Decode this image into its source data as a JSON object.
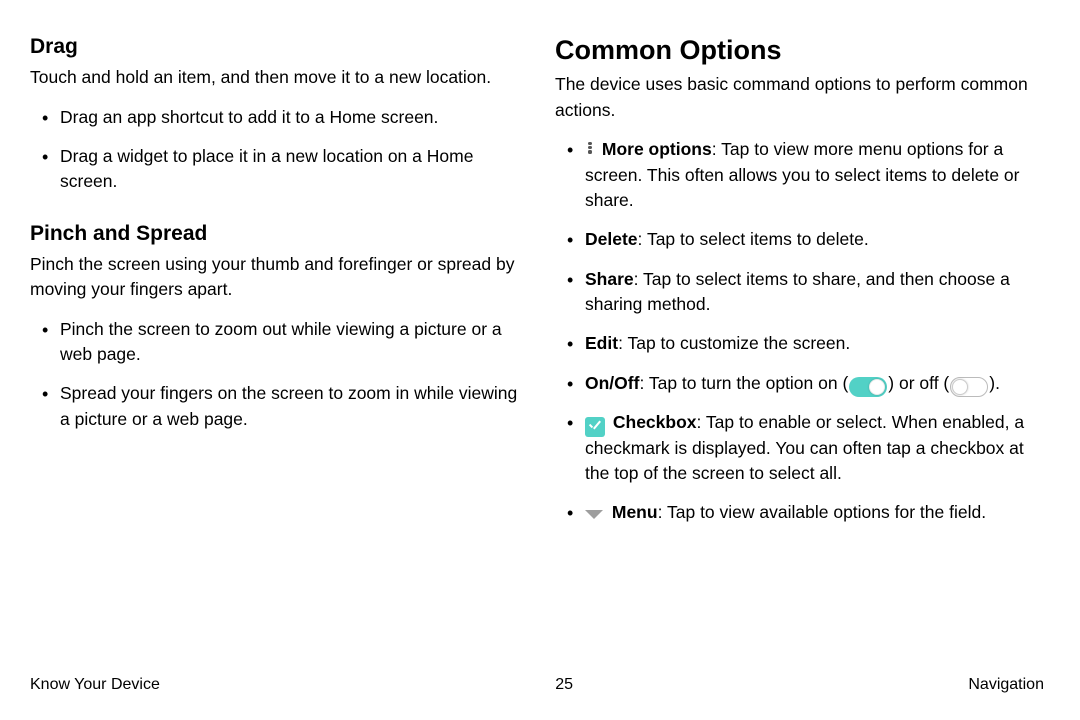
{
  "left": {
    "drag": {
      "heading": "Drag",
      "intro": "Touch and hold an item, and then move it to a new location.",
      "bullets": [
        "Drag an app shortcut to add it to a Home screen.",
        "Drag a widget to place it in a new location on a Home screen."
      ]
    },
    "pinch": {
      "heading": "Pinch and Spread",
      "intro": "Pinch the screen using your thumb and forefinger or spread by moving your fingers apart.",
      "bullets": [
        "Pinch the screen to zoom out while viewing a picture or a web page.",
        "Spread your fingers on the screen to zoom in while viewing a picture or a web page."
      ]
    }
  },
  "right": {
    "heading": "Common Options",
    "intro": "The device uses basic command options to perform common actions.",
    "items": {
      "more": {
        "label": "More options",
        "text": ": Tap to view more menu options for a screen. This often allows you to select items to delete or share."
      },
      "delete": {
        "label": "Delete",
        "text": ": Tap to select items to delete."
      },
      "share": {
        "label": "Share",
        "text": ": Tap to select items to share, and then choose a sharing method."
      },
      "edit": {
        "label": "Edit",
        "text": ": Tap to customize the screen."
      },
      "onoff": {
        "label": "On/Off",
        "pre": ": Tap to turn the option on (",
        "mid": ") or off (",
        "post": ")."
      },
      "checkbox": {
        "label": "Checkbox",
        "text": ": Tap to enable or select. When enabled, a checkmark is displayed. You can often tap a checkbox at the top of the screen to select all."
      },
      "menu": {
        "label": "Menu",
        "text": ": Tap to view available options for the field."
      }
    }
  },
  "footer": {
    "left": "Know Your Device",
    "page": "25",
    "right": "Navigation"
  }
}
